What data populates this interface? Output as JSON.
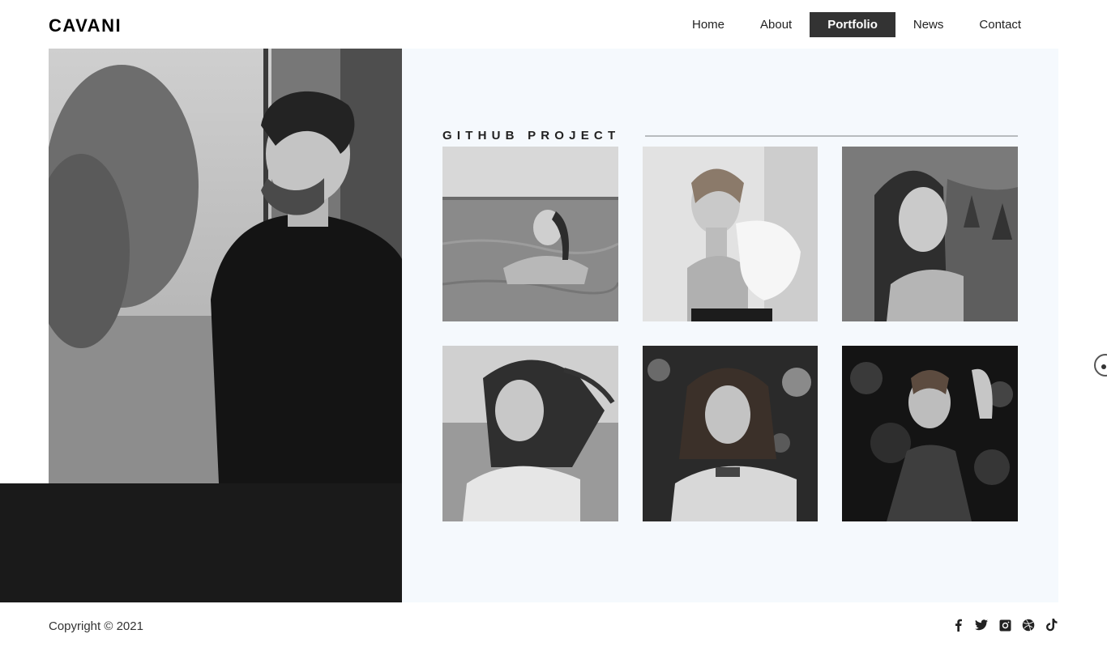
{
  "brand": {
    "logo": "CAVANI"
  },
  "nav": {
    "items": [
      {
        "label": "Home"
      },
      {
        "label": "About"
      },
      {
        "label": "Portfolio",
        "active": true
      },
      {
        "label": "News"
      },
      {
        "label": "Contact"
      }
    ]
  },
  "portfolio": {
    "section_title": "GITHUB PROJECT",
    "items": [
      {
        "image": "portrait-photo"
      },
      {
        "image": "portrait-photo"
      },
      {
        "image": "portrait-photo"
      },
      {
        "image": "portrait-photo"
      },
      {
        "image": "portrait-photo"
      },
      {
        "image": "portrait-photo"
      }
    ]
  },
  "hero": {
    "image": "man-portrait-photo"
  },
  "footer": {
    "copyright": "Copyright © 2021",
    "social": [
      "facebook-icon",
      "twitter-icon",
      "instagram-icon",
      "dribbble-icon",
      "tiktok-icon"
    ]
  },
  "colors": {
    "active_nav": "#333333",
    "content_bg": "#f5f9fd",
    "dark_block": "#1a1a1a"
  }
}
